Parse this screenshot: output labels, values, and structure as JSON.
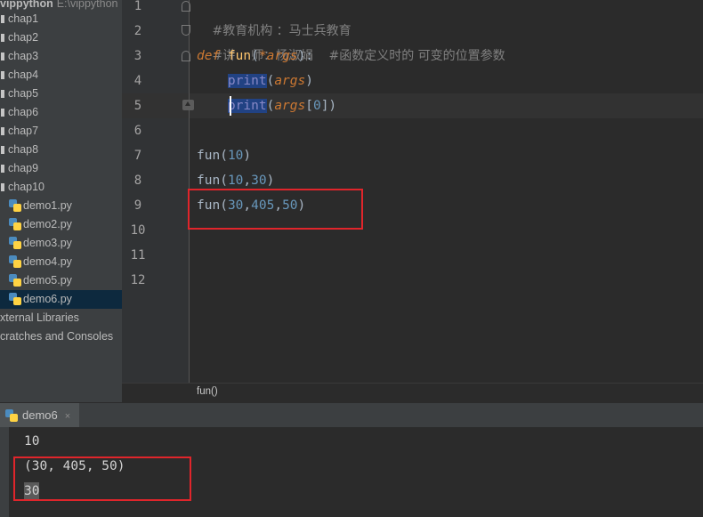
{
  "colors": {
    "annotation_box": "#e0252b",
    "selected_tree_row": "#0d293e"
  },
  "project_tree": {
    "root": {
      "title": "vippython",
      "path": "E:\\vippython"
    },
    "items": [
      {
        "label": "chap1",
        "kind": "folder",
        "icon": "folder-icon"
      },
      {
        "label": "chap2",
        "kind": "folder",
        "icon": "folder-icon"
      },
      {
        "label": "chap3",
        "kind": "folder",
        "icon": "folder-icon"
      },
      {
        "label": "chap4",
        "kind": "folder",
        "icon": "folder-icon"
      },
      {
        "label": "chap5",
        "kind": "folder",
        "icon": "folder-icon"
      },
      {
        "label": "chap6",
        "kind": "folder",
        "icon": "folder-icon"
      },
      {
        "label": "chap7",
        "kind": "folder",
        "icon": "folder-icon"
      },
      {
        "label": "chap8",
        "kind": "folder",
        "icon": "folder-icon"
      },
      {
        "label": "chap9",
        "kind": "folder",
        "icon": "folder-icon"
      },
      {
        "label": "chap10",
        "kind": "folder",
        "icon": "folder-icon"
      },
      {
        "label": "demo1.py",
        "kind": "file",
        "icon": "python-file-icon"
      },
      {
        "label": "demo2.py",
        "kind": "file",
        "icon": "python-file-icon"
      },
      {
        "label": "demo3.py",
        "kind": "file",
        "icon": "python-file-icon"
      },
      {
        "label": "demo4.py",
        "kind": "file",
        "icon": "python-file-icon"
      },
      {
        "label": "demo5.py",
        "kind": "file",
        "icon": "python-file-icon"
      },
      {
        "label": "demo6.py",
        "kind": "file",
        "icon": "python-file-icon",
        "selected": true
      },
      {
        "label": "xternal Libraries",
        "kind": "node"
      },
      {
        "label": "cratches and Consoles",
        "kind": "node"
      }
    ]
  },
  "editor": {
    "line_numbers": [
      "1",
      "2",
      "3",
      "4",
      "5",
      "6",
      "7",
      "8",
      "9",
      "10",
      "11",
      "12"
    ],
    "current_line": "5",
    "code": {
      "l1": "#教育机构 ：马士兵教育",
      "l2": "#讲    师：杨淑娟",
      "l3": {
        "kw": "def",
        "name": "fun",
        "open": "(",
        "param": "*args",
        "close": "):",
        "comment": "#函数定义时的 可变的位置参数"
      },
      "l4": {
        "call": "print",
        "open": "(",
        "arg": "args",
        "close": ")"
      },
      "l5": {
        "call": "print",
        "open": "(",
        "arg": "args",
        "idx_open": "[",
        "idx": "0",
        "idx_close": "])"
      },
      "l7": {
        "name": "fun",
        "open": "(",
        "a": "10",
        "close": ")"
      },
      "l8": {
        "name": "fun",
        "open": "(",
        "a": "10",
        "sep": ",",
        "b": "30",
        "close": ")"
      },
      "l9": {
        "name": "fun",
        "open": "(",
        "a": "30",
        "sep1": ",",
        "b": "405",
        "sep2": ",",
        "c": "50",
        "close": ")"
      }
    },
    "breadcrumb": "fun()"
  },
  "run_panel": {
    "tab_label": "demo6",
    "tab_icon": "python-file-icon",
    "close_glyph": "×",
    "output_lines": [
      "10",
      "(30, 405, 50)",
      "30"
    ]
  }
}
